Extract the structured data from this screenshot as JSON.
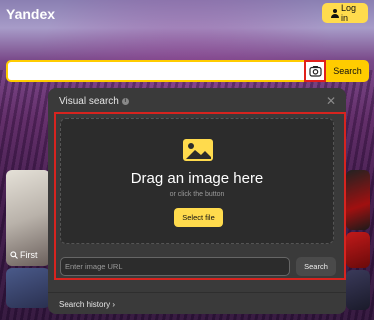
{
  "header": {
    "logo": "Yandex",
    "login_label": "Log in"
  },
  "search": {
    "value": "",
    "button_label": "Search"
  },
  "tiles": {
    "first_label": "First"
  },
  "visual_search": {
    "title": "Visual search",
    "info_glyph": "i",
    "close_glyph": "✕",
    "drag_text": "Drag an image here",
    "or_text": "or click the button",
    "select_file_label": "Select file",
    "url_placeholder": "Enter image URL",
    "url_search_label": "Search",
    "history_label": "Search history",
    "history_chevron": "›"
  },
  "colors": {
    "accent": "#ffdb4d",
    "highlight": "#d7241f",
    "panel": "#3a3a3a"
  }
}
